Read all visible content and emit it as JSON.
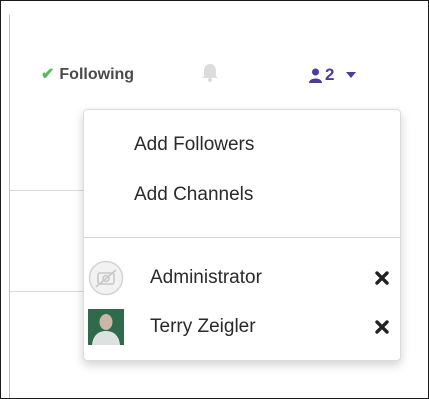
{
  "follow_status": {
    "label": "Following",
    "icon": "check-icon",
    "icon_color": "#5cb85c"
  },
  "notifications": {
    "icon": "bell-icon"
  },
  "followers": {
    "count": "2",
    "icon": "user-icon",
    "accent_color": "#4e3aa0"
  },
  "menu": {
    "actions": [
      {
        "label": "Add Followers"
      },
      {
        "label": "Add Channels"
      }
    ],
    "followers": [
      {
        "name": "Administrator",
        "avatar": "placeholder-avatar"
      },
      {
        "name": "Terry Zeigler",
        "avatar": "photo-avatar"
      }
    ]
  }
}
